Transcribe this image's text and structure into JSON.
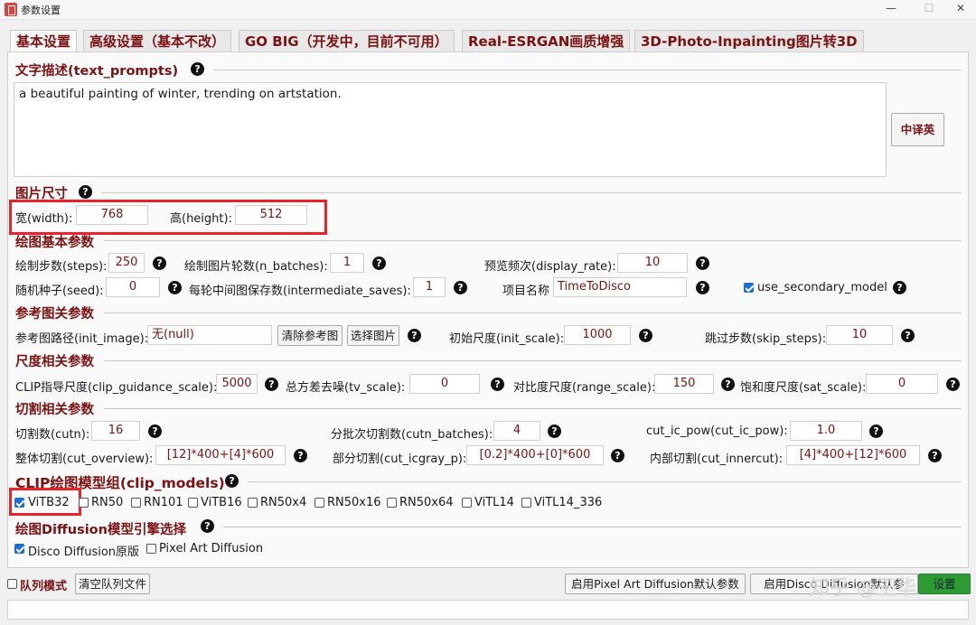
{
  "window": {
    "title": "参数设置",
    "controls": [
      "—",
      "☐",
      "✕"
    ]
  },
  "tabs": [
    {
      "label": "基本设置",
      "active": true
    },
    {
      "label": "高级设置（基本不改）"
    },
    {
      "label": "GO BIG（开发中，目前不可用）"
    },
    {
      "label": "Real-ESRGAN画质增强"
    },
    {
      "label": "3D-Photo-Inpainting图片转3D"
    }
  ],
  "help_glyph": "?",
  "text_prompts": {
    "title": "文字描述(text_prompts)",
    "value": "a beautiful painting of winter, trending on artstation.",
    "translate_button": "中译英"
  },
  "image_size": {
    "title": "图片尺寸",
    "width_label": "宽(width):",
    "width_value": "768",
    "height_label": "高(height):",
    "height_value": "512"
  },
  "basic_params": {
    "title": "绘图基本参数",
    "steps_label": "绘制步数(steps):",
    "steps_value": "250",
    "n_batches_label": "绘制图片轮数(n_batches):",
    "n_batches_value": "1",
    "display_rate_label": "预览频次(display_rate):",
    "display_rate_value": "10",
    "seed_label": "随机种子(seed):",
    "seed_value": "0",
    "intermediate_label": "每轮中间图保存数(intermediate_saves):",
    "intermediate_value": "1",
    "project_label": "项目名称",
    "project_value": "TimeToDisco",
    "secondary_label": "use_secondary_model",
    "secondary_checked": true
  },
  "init_image": {
    "title": "参考图关参数",
    "path_label": "参考图路径(init_image):",
    "path_value": "无(null)",
    "clear_button": "清除参考图",
    "select_button": "选择图片",
    "init_scale_label": "初始尺度(init_scale):",
    "init_scale_value": "1000",
    "skip_steps_label": "跳过步数(skip_steps):",
    "skip_steps_value": "10"
  },
  "scales": {
    "title": "尺度相关参数",
    "clip_label": "CLIP指导尺度(clip_guidance_scale):",
    "clip_value": "5000",
    "tv_label": "总方差去噪(tv_scale):",
    "tv_value": "0",
    "range_label": "对比度尺度(range_scale):",
    "range_value": "150",
    "sat_label": "饱和度尺度(sat_scale):",
    "sat_value": "0"
  },
  "cuts": {
    "title": "切割相关参数",
    "cutn_label": "切割数(cutn):",
    "cutn_value": "16",
    "cutn_batches_label": "分批次切割数(cutn_batches):",
    "cutn_batches_value": "4",
    "cut_ic_pow_label": "cut_ic_pow(cut_ic_pow):",
    "cut_ic_pow_value": "1.0",
    "overview_label": "整体切割(cut_overview):",
    "overview_value": "[12]*400+[4]*600",
    "icgray_label": "部分切割(cut_icgray_p):",
    "icgray_value": "[0.2]*400+[0]*600",
    "innercut_label": "内部切割(cut_innercut):",
    "innercut_value": "[4]*400+[12]*600"
  },
  "clip_models": {
    "title": "CLIP绘图模型组(clip_models)",
    "items": [
      {
        "label": "ViTB32",
        "checked": true
      },
      {
        "label": "RN50",
        "checked": false
      },
      {
        "label": "RN101",
        "checked": false
      },
      {
        "label": "ViTB16",
        "checked": false
      },
      {
        "label": "RN50x4",
        "checked": false
      },
      {
        "label": "RN50x16",
        "checked": false
      },
      {
        "label": "RN50x64",
        "checked": false
      },
      {
        "label": "ViTL14",
        "checked": false
      },
      {
        "label": "ViTL14_336",
        "checked": false
      }
    ]
  },
  "diffusion": {
    "title": "绘图Diffusion模型引擎选择",
    "options": [
      {
        "label": "Disco Diffusion原版",
        "checked": true
      },
      {
        "label": "Pixel Art Diffusion",
        "checked": false
      }
    ]
  },
  "bottom": {
    "queue_mode_label": "队列模式",
    "clear_queue_button": "清空队列文件",
    "pixel_art_default_button": "启用Pixel Art Diffusion默认参数",
    "disco_default_button": "启用Disco Diffusion默认参",
    "save_button": "设置"
  },
  "watermark": "知乎 @王华",
  "colors": {
    "accent": "#7a1212",
    "highlight_box": "#e8242b",
    "check_blue": "#1a6fd0",
    "save_green": "#2e9b35"
  }
}
